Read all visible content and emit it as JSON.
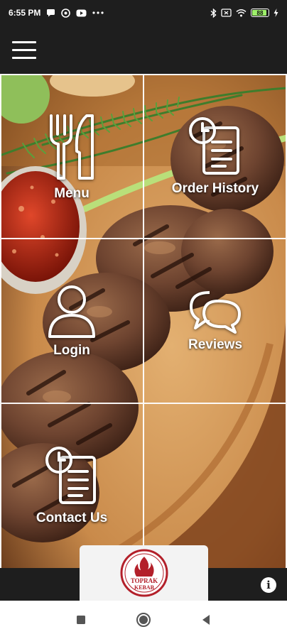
{
  "status_bar": {
    "time": "6:55 PM",
    "left_icons": [
      "chat-icon",
      "settings-badge-icon",
      "youtube-icon",
      "more-dots-icon"
    ],
    "right_icons": [
      "bluetooth-icon",
      "sim-icon",
      "wifi-icon",
      "battery-icon",
      "charging-icon"
    ],
    "battery_level": "88"
  },
  "app_bar": {
    "menu_icon": "hamburger-icon"
  },
  "tiles": [
    {
      "label": "Menu",
      "icon": "fork-knife-icon"
    },
    {
      "label": "Order History",
      "icon": "clock-document-icon"
    },
    {
      "label": "Login",
      "icon": "user-icon"
    },
    {
      "label": "Reviews",
      "icon": "chat-bubbles-icon"
    },
    {
      "label": "Contact Us",
      "icon": "clock-document-icon"
    }
  ],
  "logo": {
    "line1": "TOPRAK",
    "line2": "KEBAB",
    "icon": "flame-icon"
  },
  "info_button": {
    "glyph": "i"
  },
  "nav_bar": {
    "buttons": [
      "recents-button",
      "home-button",
      "back-button"
    ]
  },
  "colors": {
    "bar_dark": "#1e1e1e",
    "grid_line": "#ffffff",
    "logo_red": "#b3202a"
  }
}
